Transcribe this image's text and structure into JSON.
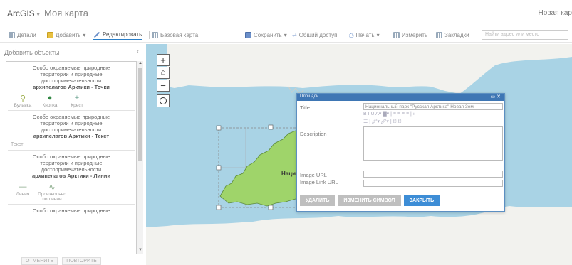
{
  "header": {
    "brand": "ArcGIS",
    "map_title": "Моя карта",
    "new_map": "Новая кар"
  },
  "toolbar": {
    "details": "Детали",
    "add": "Добавить",
    "edit": "Редактировать",
    "basemap": "Базовая карта",
    "save": "Сохранить",
    "share": "Общий доступ",
    "print": "Печать",
    "measure": "Измерить",
    "bookmarks": "Закладки",
    "search_placeholder": "Найти адрес или место"
  },
  "panel": {
    "title": "Добавить объекты",
    "groups": [
      {
        "title_lines": [
          "Особо охраняемые природные",
          "территории и природные",
          "достопримечательности"
        ],
        "title_bold": "архипелагов Арктики - Точки",
        "symbols": [
          "Булавка",
          "Кнопка",
          "Крест"
        ]
      },
      {
        "title_lines": [
          "Особо охраняемые природные",
          "территории и природные",
          "достопримечательности"
        ],
        "title_bold": "архипелагов Арктики - Текст",
        "text_item": "Текст"
      },
      {
        "title_lines": [
          "Особо охраняемые природные",
          "территории и природные",
          "достопримечательности"
        ],
        "title_bold": "архипелагов Арктики - Линии",
        "symbols": [
          "Линия",
          "Произвольно по линии"
        ]
      },
      {
        "title_lines": [
          "Особо охраняемые природные"
        ]
      }
    ],
    "cancel": "ОТМЕНИТЬ",
    "undo": "ПОВТОРИТЬ"
  },
  "map": {
    "feature_label": "Наци"
  },
  "popup": {
    "title": "Площади",
    "fields": {
      "title_label": "Title",
      "title_value": "Национальный парк \"Русская Арктика\" Новая Зем",
      "description_label": "Description",
      "image_url_label": "Image URL",
      "image_link_label": "Image Link URL"
    },
    "rte_row1": "B  I  U  A▾  ▇▾  |  ≡  ≡  ≡  ≡  |  ⁝",
    "rte_row2": "☰  |  🖉▾  🖉▾  |  ⛓  ⛓",
    "buttons": {
      "delete": "УДАЛИТЬ",
      "change_symbol": "ИЗМЕНИТЬ СИМВОЛ",
      "close": "ЗАКРЫТЬ"
    }
  },
  "colors": {
    "water": "#a9d3e5",
    "land_feature": "#9fd46a",
    "accent": "#3d8dd6"
  }
}
